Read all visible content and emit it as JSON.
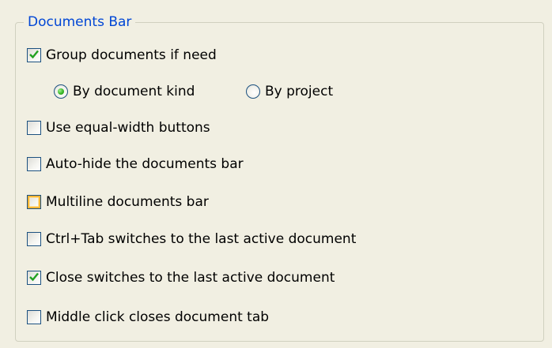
{
  "group": {
    "title": "Documents Bar"
  },
  "options": [
    {
      "label": "Group documents if need",
      "checked": true
    },
    {
      "label": "Use equal-width buttons",
      "checked": false
    },
    {
      "label": "Auto-hide the documents bar",
      "checked": false
    },
    {
      "label": "Multiline documents bar",
      "checked": false
    },
    {
      "label": "Ctrl+Tab switches to the last active document",
      "checked": false
    },
    {
      "label": "Close switches to the last active document",
      "checked": true
    },
    {
      "label": "Middle click closes document tab",
      "checked": false
    }
  ],
  "grouping_mode": {
    "options": [
      {
        "label": "By document kind",
        "selected": true
      },
      {
        "label": "By project",
        "selected": false
      }
    ]
  },
  "colors": {
    "legend": "#0046d5",
    "check": "#21a121",
    "hover_ring": "#f8b636"
  },
  "icons": {
    "check": "checkmark-icon",
    "radio": "radio-dot-icon"
  }
}
